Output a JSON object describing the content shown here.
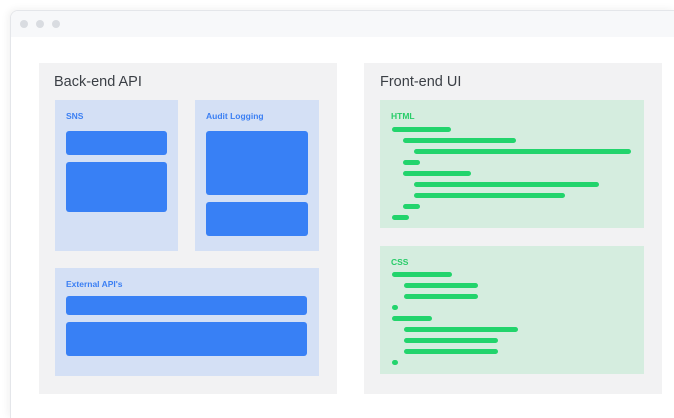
{
  "backend": {
    "title": "Back-end API",
    "sns_label": "SNS",
    "audit_label": "Audit Logging",
    "external_label": "External API's"
  },
  "frontend": {
    "title": "Front-end UI",
    "html_label": "HTML",
    "css_label": "CSS"
  },
  "colors": {
    "blue_block": "#3880f5",
    "blue_box": "#d4e0f5",
    "green_code": "#22d46c",
    "green_box": "#d5eddf"
  }
}
